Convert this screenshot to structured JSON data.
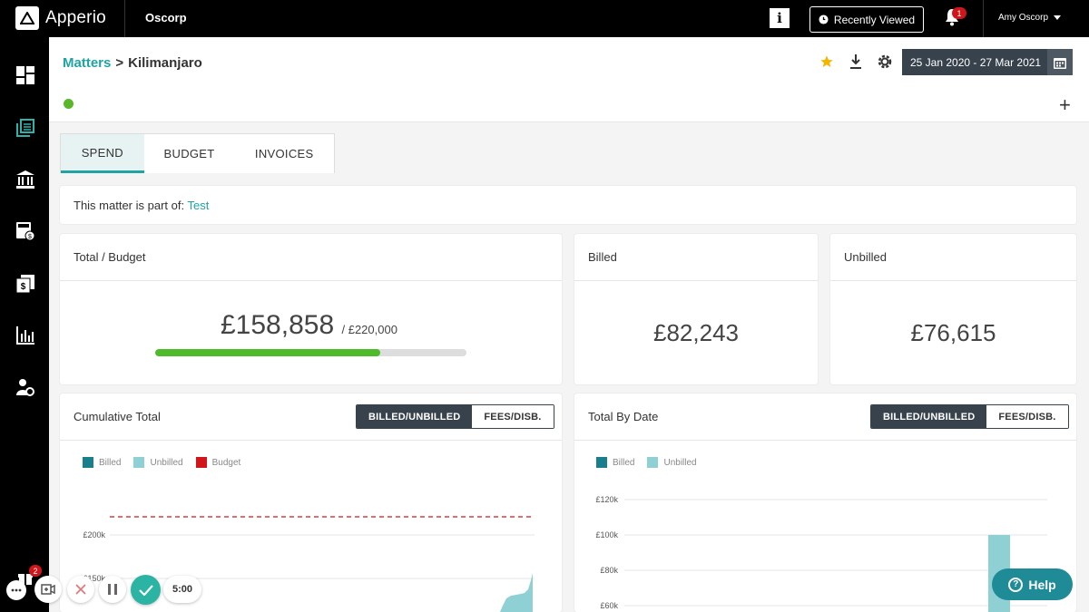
{
  "app": {
    "name": "Apperio",
    "org": "Oscorp"
  },
  "topbar": {
    "info_label": "i",
    "recent_label": "Recently Viewed",
    "notification_count": "1",
    "user_name": "Amy Oscorp"
  },
  "breadcrumb": {
    "parent": "Matters",
    "separator": ">",
    "current": "Kilimanjaro"
  },
  "header": {
    "date_range": "25 Jan 2020 - 27 Mar 2021",
    "add_label": "+"
  },
  "tabs": [
    {
      "label": "SPEND",
      "active": true
    },
    {
      "label": "BUDGET",
      "active": false
    },
    {
      "label": "INVOICES",
      "active": false
    }
  ],
  "parent_matter": {
    "prefix": "This matter is part of: ",
    "link": "Test"
  },
  "total_budget": {
    "title": "Total / Budget",
    "total": "£158,858",
    "budget": "/ £220,000",
    "progress_fraction": 0.722
  },
  "billed": {
    "title": "Billed",
    "value": "£82,243"
  },
  "unbilled": {
    "title": "Unbilled",
    "value": "£76,615"
  },
  "cumulative": {
    "title": "Cumulative Total",
    "toggle_on": "BILLED/UNBILLED",
    "toggle_off": "FEES/DISB.",
    "legend": [
      "Billed",
      "Unbilled",
      "Budget"
    ]
  },
  "by_date": {
    "title": "Total By Date",
    "toggle_on": "BILLED/UNBILLED",
    "toggle_off": "FEES/DISB.",
    "legend": [
      "Billed",
      "Unbilled"
    ]
  },
  "chart_data": [
    {
      "type": "area",
      "title": "Cumulative Total",
      "legend": [
        "Billed",
        "Unbilled",
        "Budget"
      ],
      "y_ticks": [
        "£200k",
        "£150k"
      ],
      "series": [
        {
          "name": "Budget",
          "values": [
            220000
          ]
        }
      ],
      "colors": {
        "Billed": "#1a7f8c",
        "Unbilled": "#8fd0d5",
        "Budget": "#d0161b"
      }
    },
    {
      "type": "bar",
      "title": "Total By Date",
      "legend": [
        "Billed",
        "Unbilled"
      ],
      "y_ticks": [
        "£120k",
        "£100k",
        "£80k",
        "£60k"
      ],
      "series": [
        {
          "name": "Unbilled",
          "values": [
            100000
          ]
        }
      ],
      "colors": {
        "Billed": "#1a7f8c",
        "Unbilled": "#8fd0d5"
      }
    }
  ],
  "widget": {
    "sidebar_badge": "2",
    "timer": "5:00"
  },
  "help": {
    "label": "Help",
    "icon": "?"
  }
}
